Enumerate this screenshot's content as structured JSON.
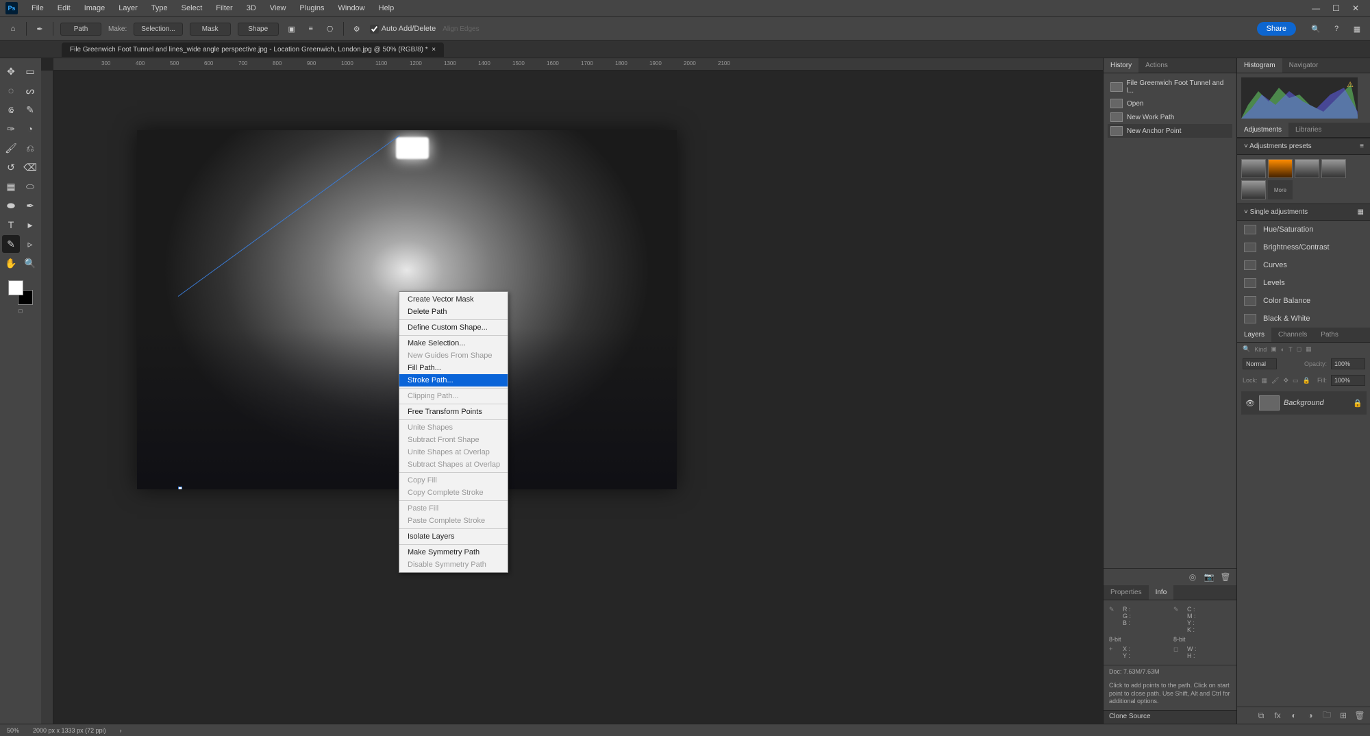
{
  "app": {
    "logo": "Ps"
  },
  "menu": [
    "File",
    "Edit",
    "Image",
    "Layer",
    "Type",
    "Select",
    "Filter",
    "3D",
    "View",
    "Plugins",
    "Window",
    "Help"
  ],
  "options_bar": {
    "path_label": "Path",
    "make_label": "Make:",
    "selection_btn": "Selection...",
    "mask_btn": "Mask",
    "shape_btn": "Shape",
    "auto_add_label": "Auto Add/Delete",
    "align_label": "Align Edges",
    "share": "Share"
  },
  "doc_tab": "File Greenwich Foot Tunnel and lines_wide angle perspective.jpg - Location Greenwich, London.jpg @ 50% (RGB/8) *",
  "ruler_marks": [
    "300",
    "400",
    "500",
    "600",
    "700",
    "800",
    "900",
    "1000",
    "1100",
    "1200",
    "1300",
    "1400",
    "1500",
    "1600",
    "1700",
    "1800",
    "1900",
    "2000",
    "2100"
  ],
  "context_menu": [
    {
      "label": "Create Vector Mask",
      "enabled": true
    },
    {
      "label": "Delete Path",
      "enabled": true
    },
    {
      "sep": true
    },
    {
      "label": "Define Custom Shape...",
      "enabled": true
    },
    {
      "sep": true
    },
    {
      "label": "Make Selection...",
      "enabled": true
    },
    {
      "label": "New Guides From Shape",
      "enabled": false
    },
    {
      "label": "Fill Path...",
      "enabled": true
    },
    {
      "label": "Stroke Path...",
      "enabled": true,
      "highlight": true
    },
    {
      "sep": true
    },
    {
      "label": "Clipping Path...",
      "enabled": false
    },
    {
      "sep": true
    },
    {
      "label": "Free Transform Points",
      "enabled": true
    },
    {
      "sep": true
    },
    {
      "label": "Unite Shapes",
      "enabled": false
    },
    {
      "label": "Subtract Front Shape",
      "enabled": false
    },
    {
      "label": "Unite Shapes at Overlap",
      "enabled": false
    },
    {
      "label": "Subtract Shapes at Overlap",
      "enabled": false
    },
    {
      "sep": true
    },
    {
      "label": "Copy Fill",
      "enabled": false
    },
    {
      "label": "Copy Complete Stroke",
      "enabled": false
    },
    {
      "sep": true
    },
    {
      "label": "Paste Fill",
      "enabled": false
    },
    {
      "label": "Paste Complete Stroke",
      "enabled": false
    },
    {
      "sep": true
    },
    {
      "label": "Isolate Layers",
      "enabled": true
    },
    {
      "sep": true
    },
    {
      "label": "Make Symmetry Path",
      "enabled": true
    },
    {
      "label": "Disable Symmetry Path",
      "enabled": false
    }
  ],
  "panels": {
    "history": {
      "tab": "History",
      "actions_tab": "Actions",
      "file": "File Greenwich Foot Tunnel and l...",
      "items": [
        "Open",
        "New Work Path",
        "New Anchor Point"
      ]
    },
    "histogram": {
      "tab": "Histogram",
      "nav_tab": "Navigator"
    },
    "adjustments": {
      "tab": "Adjustments",
      "lib_tab": "Libraries",
      "presets_header": "Adjustments presets",
      "single_header": "Single adjustments",
      "more": "More",
      "items": [
        "Hue/Saturation",
        "Brightness/Contrast",
        "Curves",
        "Levels",
        "Color Balance",
        "Black & White"
      ]
    },
    "layers": {
      "tab": "Layers",
      "channels_tab": "Channels",
      "paths_tab": "Paths",
      "kind": "Kind",
      "normal": "Normal",
      "opacity_label": "Opacity:",
      "opacity_val": "100%",
      "lock_label": "Lock:",
      "fill_label": "Fill:",
      "fill_val": "100%",
      "bg": "Background"
    },
    "properties": {
      "tab": "Properties",
      "info_tab": "Info"
    },
    "info": {
      "rgb": {
        "r": "R :",
        "g": "G :",
        "b": "B :"
      },
      "cmyk": {
        "c": "C :",
        "m": "M :",
        "y": "Y :",
        "k": "K :"
      },
      "xy": {
        "x": "X :",
        "y": "Y :"
      },
      "wh": {
        "w": "W :",
        "h": "H :"
      },
      "bit1": "8-bit",
      "bit2": "8-bit",
      "doc": "Doc: 7.63M/7.63M",
      "hint": "Click to add points to the path.  Click on start point to close path.  Use Shift, Alt and Ctrl for additional options."
    },
    "clone": "Clone Source"
  },
  "status": {
    "zoom": "50%",
    "dims": "2000 px x 1333 px (72 ppi)"
  }
}
